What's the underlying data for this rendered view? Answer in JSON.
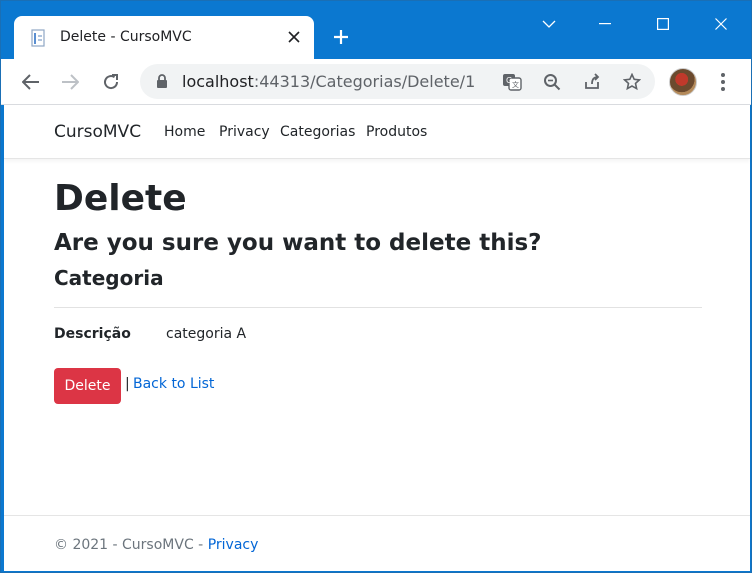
{
  "browser": {
    "tab_title": "Delete - CursoMVC",
    "new_tab_glyph": "+",
    "close_glyph": "✕",
    "url_host": "localhost",
    "url_rest": ":44313/Categorias/Delete/1",
    "accent_color": "#0b78d0"
  },
  "navbar": {
    "brand": "CursoMVC",
    "links": [
      "Home",
      "Privacy",
      "Categorias",
      "Produtos"
    ]
  },
  "content": {
    "heading": "Delete",
    "confirm_text": "Are you sure you want to delete this?",
    "entity_name": "Categoria",
    "field_label": "Descrição",
    "field_value": "categoria A",
    "delete_button": "Delete",
    "separator": "|",
    "back_link": "Back to List",
    "danger_color": "#dc3545",
    "link_color": "#0366d6"
  },
  "footer": {
    "copyright": "© 2021 - CursoMVC - ",
    "privacy_link": "Privacy"
  }
}
